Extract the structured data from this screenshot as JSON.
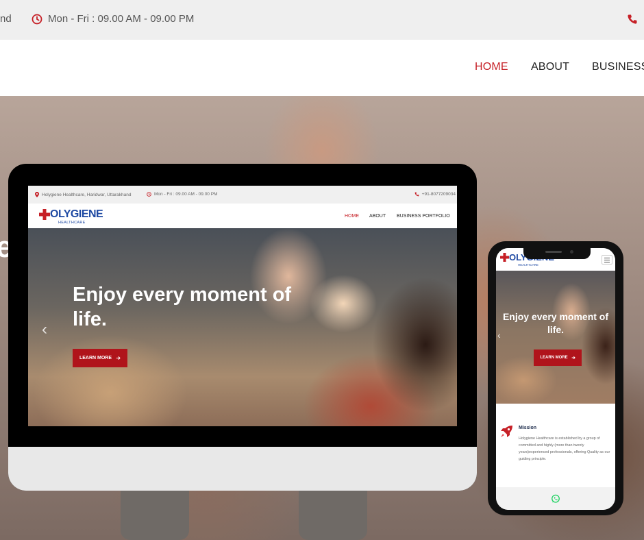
{
  "topbar": {
    "left_fragment": "nd",
    "hours": "Mon - Fri : 09.00 AM - 09.00 PM"
  },
  "nav": {
    "home": "HOME",
    "about": "ABOUT",
    "business": "BUSINESS"
  },
  "hero": {
    "fragment": "e"
  },
  "desktop": {
    "topbar": {
      "address": "Holygiene Healthcare, Haridwar, Uttarakhand",
      "hours": "Mon - Fri : 09.00 AM - 09.00 PM",
      "phone": "+91-8077209034"
    },
    "logo": {
      "main": "OLYGIENE",
      "sub": "HEALTHCARE"
    },
    "nav": {
      "home": "HOME",
      "about": "ABOUT",
      "business_portfolio": "BUSINESS PORTFOLIO"
    },
    "hero": {
      "headline": "Enjoy every moment of life.",
      "button": "LEARN MORE",
      "arrow": "‹"
    }
  },
  "mobile": {
    "logo": {
      "main": "OLYGIENE",
      "sub": "HEALTHCARE"
    },
    "hero": {
      "headline": "Enjoy every moment of life.",
      "button": "LEARN MORE",
      "arrow": "‹"
    },
    "mission": {
      "title": "Mission",
      "text": "Holygiene Healthcare is established by a group of committed and highly (more than twenty years)experienced professionals, offering Quality as our guiding principle."
    }
  },
  "colors": {
    "brand_red": "#c62027",
    "button_red": "#b0141b",
    "logo_blue": "#1f4aa3",
    "whatsapp_green": "#25d366"
  },
  "icons": [
    "clock-icon",
    "phone-icon",
    "location-pin-icon",
    "arrow-right-icon",
    "chevron-left-icon",
    "rocket-icon",
    "whatsapp-icon",
    "hamburger-menu-icon",
    "red-cross-logo-icon"
  ]
}
